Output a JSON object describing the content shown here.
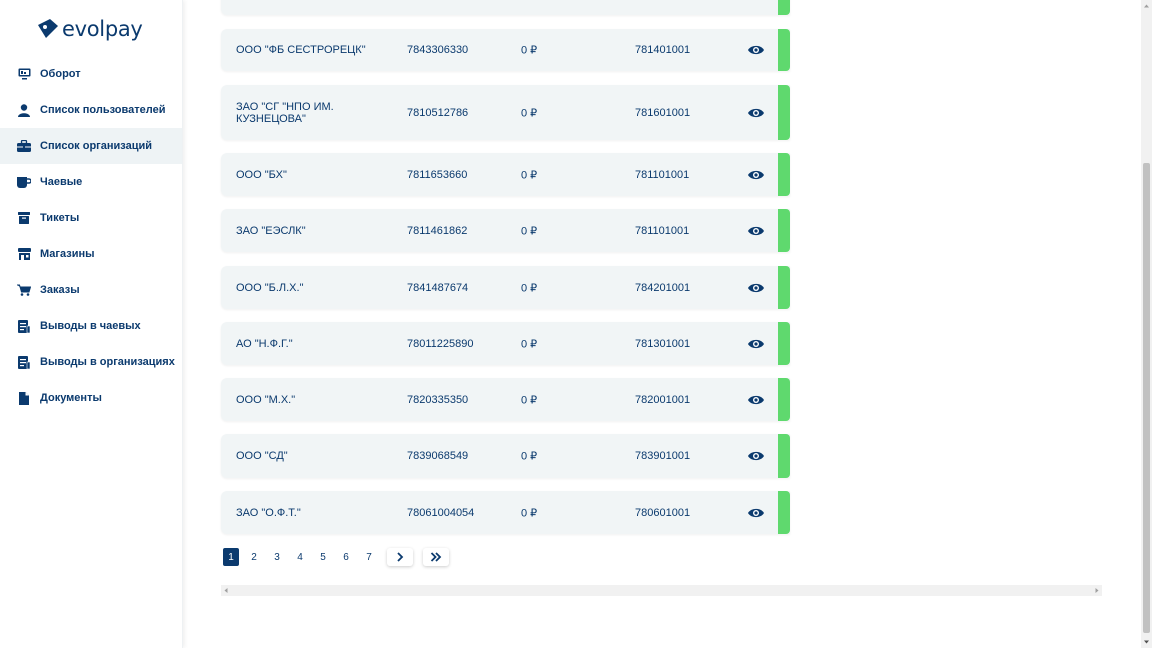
{
  "app": {
    "logo_text": "evolpay"
  },
  "sidebar": {
    "items": [
      {
        "label": "Оборот",
        "icon": "monitor-icon"
      },
      {
        "label": "Список пользователей",
        "icon": "user-icon"
      },
      {
        "label": "Список организаций",
        "icon": "briefcase-icon",
        "active": true
      },
      {
        "label": "Чаевые",
        "icon": "cup-icon"
      },
      {
        "label": "Тикеты",
        "icon": "ticket-box-icon"
      },
      {
        "label": "Магазины",
        "icon": "store-icon"
      },
      {
        "label": "Заказы",
        "icon": "cart-icon"
      },
      {
        "label": "Выводы в чаевых",
        "icon": "receipt-icon"
      },
      {
        "label": "Выводы в организациях",
        "icon": "receipt-icon"
      },
      {
        "label": "Документы",
        "icon": "document-icon"
      }
    ]
  },
  "organizations": {
    "rows": [
      {
        "name": "ООО \"ФБ СЕСТРОРЕЦК\"",
        "inn": "7843306330",
        "balance": "0 ₽",
        "kpp": "781401001"
      },
      {
        "name": "ЗАО \"СГ \"НПО ИМ. КУЗНЕЦОВА\"",
        "inn": "7810512786",
        "balance": "0 ₽",
        "kpp": "781601001"
      },
      {
        "name": "ООО \"БХ\"",
        "inn": "7811653660",
        "balance": "0 ₽",
        "kpp": "781101001"
      },
      {
        "name": "ЗАО \"ЕЭСЛК\"",
        "inn": "7811461862",
        "balance": "0 ₽",
        "kpp": "781101001"
      },
      {
        "name": "ООО \"Б.Л.Х.\"",
        "inn": "7841487674",
        "balance": "0 ₽",
        "kpp": "784201001"
      },
      {
        "name": "АО \"Н.Ф.Г.\"",
        "inn": "78011225890",
        "balance": "0 ₽",
        "kpp": "781301001"
      },
      {
        "name": "ООО \"М.Х.\"",
        "inn": "7820335350",
        "balance": "0 ₽",
        "kpp": "782001001"
      },
      {
        "name": "ООО \"СД\"",
        "inn": "7839068549",
        "balance": "0 ₽",
        "kpp": "783901001"
      },
      {
        "name": "ЗАО \"О.Ф.Т.\"",
        "inn": "78061004054",
        "balance": "0 ₽",
        "kpp": "780601001"
      }
    ],
    "status_color": "#5fd96e"
  },
  "pagination": {
    "pages": [
      "1",
      "2",
      "3",
      "4",
      "5",
      "6",
      "7"
    ],
    "current": "1",
    "next_icon": "chevron-right-icon",
    "last_icon": "double-chevron-right-icon"
  },
  "colors": {
    "accent": "#0b3a6e",
    "row_bg": "#f1f5f6",
    "status_active": "#5fd96e"
  }
}
